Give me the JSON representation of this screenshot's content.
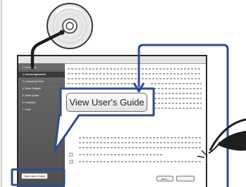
{
  "installer": {
    "menu": [
      {
        "label": "1. Introduction",
        "selected": false
      },
      {
        "label": "2. License Agreement",
        "selected": true
      },
      {
        "label": "3. Connecting Printer",
        "selected": false
      },
      {
        "label": "4. Select Software",
        "selected": false
      },
      {
        "label": "5. Smart Update",
        "selected": false
      },
      {
        "label": "6. Installation",
        "selected": false
      },
      {
        "label": "7. Finish",
        "selected": false
      }
    ],
    "sidebar_button": "View User's Guide",
    "next_button": "Next >"
  },
  "callout": {
    "button_label": "View User's Guide"
  },
  "colors": {
    "outline": "#2a2a2a",
    "callout_blue": "#2f4d8f",
    "sidebar": "#5a5a5a",
    "highlight": "#ffffff"
  },
  "icons": {
    "disc": "cd-disc-icon",
    "eye": "eye-icon"
  }
}
